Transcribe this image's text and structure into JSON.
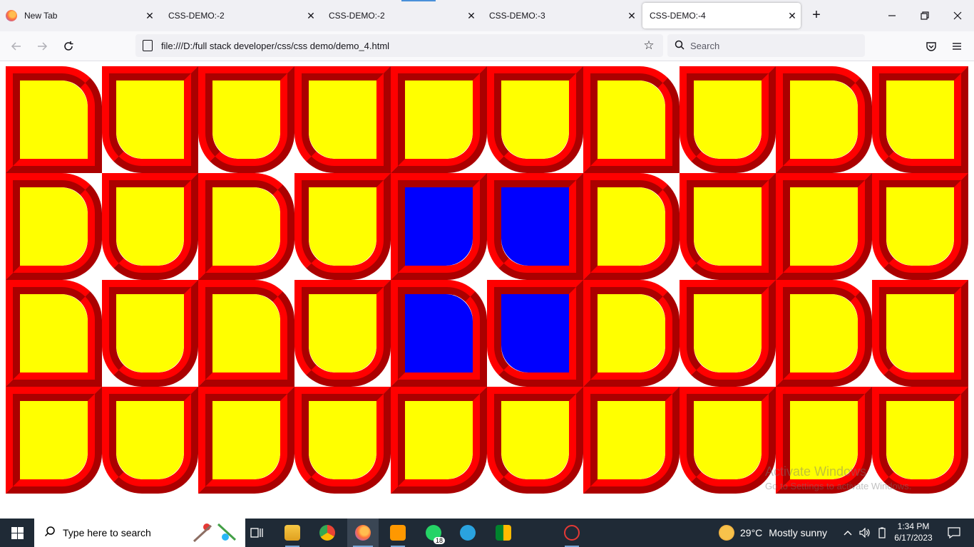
{
  "browser": {
    "tabs": [
      {
        "label": "New Tab"
      },
      {
        "label": "CSS-DEMO:-2"
      },
      {
        "label": "CSS-DEMO:-2"
      },
      {
        "label": "CSS-DEMO:-3"
      },
      {
        "label": "CSS-DEMO:-4",
        "active": true
      }
    ],
    "url": "file:///D:/full stack developer/css/css demo/demo_4.html",
    "search_placeholder": "Search"
  },
  "page": {
    "colors": {
      "border": "#ff0000",
      "fill_default": "#ffff00",
      "fill_highlight": "#0000ff"
    },
    "cells": [
      [
        {
          "color": "yellow",
          "corners": [
            "tr"
          ]
        },
        {
          "color": "yellow",
          "corners": [
            "bl"
          ]
        },
        {
          "color": "yellow",
          "corners": [
            "bl",
            "br"
          ]
        },
        {
          "color": "yellow",
          "corners": [
            "bl"
          ]
        },
        {
          "color": "yellow",
          "corners": [
            "br"
          ]
        },
        {
          "color": "yellow",
          "corners": [
            "bl",
            "br"
          ]
        },
        {
          "color": "yellow",
          "corners": [
            "tr"
          ]
        },
        {
          "color": "yellow",
          "corners": [
            "bl",
            "br"
          ]
        },
        {
          "color": "yellow",
          "corners": [
            "tr",
            "br"
          ]
        },
        {
          "color": "yellow",
          "corners": [
            "bl"
          ]
        }
      ],
      [
        {
          "color": "yellow",
          "corners": [
            "tr",
            "br"
          ]
        },
        {
          "color": "yellow",
          "corners": [
            "bl",
            "br"
          ]
        },
        {
          "color": "yellow",
          "corners": [
            "tr",
            "br"
          ]
        },
        {
          "color": "yellow",
          "corners": [
            "bl",
            "br"
          ]
        },
        {
          "color": "blue",
          "corners": [
            "br"
          ]
        },
        {
          "color": "blue",
          "corners": [
            "bl"
          ]
        },
        {
          "color": "yellow",
          "corners": [
            "tr",
            "br"
          ]
        },
        {
          "color": "yellow",
          "corners": [
            "bl"
          ]
        },
        {
          "color": "yellow",
          "corners": [
            "br"
          ]
        },
        {
          "color": "yellow",
          "corners": [
            "bl",
            "br"
          ]
        }
      ],
      [
        {
          "color": "yellow",
          "corners": [
            "tr"
          ]
        },
        {
          "color": "yellow",
          "corners": [
            "bl",
            "br"
          ]
        },
        {
          "color": "yellow",
          "corners": [
            "tr"
          ]
        },
        {
          "color": "yellow",
          "corners": [
            "bl",
            "br"
          ]
        },
        {
          "color": "blue",
          "corners": [
            "tr"
          ]
        },
        {
          "color": "blue",
          "corners": [
            "bl"
          ]
        },
        {
          "color": "yellow",
          "corners": [
            "tr",
            "br"
          ]
        },
        {
          "color": "yellow",
          "corners": [
            "bl",
            "br"
          ]
        },
        {
          "color": "yellow",
          "corners": [
            "tr",
            "br"
          ]
        },
        {
          "color": "yellow",
          "corners": [
            "bl"
          ]
        }
      ],
      [
        {
          "color": "yellow",
          "corners": [
            "br"
          ]
        },
        {
          "color": "yellow",
          "corners": [
            "bl",
            "br"
          ]
        },
        {
          "color": "yellow",
          "corners": [
            "br"
          ]
        },
        {
          "color": "yellow",
          "corners": [
            "bl",
            "br"
          ]
        },
        {
          "color": "yellow",
          "corners": [
            "br"
          ]
        },
        {
          "color": "yellow",
          "corners": [
            "bl",
            "br"
          ]
        },
        {
          "color": "yellow",
          "corners": [
            "br"
          ]
        },
        {
          "color": "yellow",
          "corners": [
            "bl",
            "br"
          ]
        },
        {
          "color": "yellow",
          "corners": [
            "br"
          ]
        },
        {
          "color": "yellow",
          "corners": [
            "bl",
            "br"
          ]
        }
      ]
    ],
    "watermark": {
      "line1": "Activate Windows",
      "line2": "Go to Settings to activate Windows."
    }
  },
  "taskbar": {
    "search_placeholder": "Type here to search",
    "whatsapp_badge": "18",
    "weather": {
      "temp": "29°C",
      "desc": "Mostly sunny"
    },
    "time": "1:34 PM",
    "date": "6/17/2023"
  }
}
